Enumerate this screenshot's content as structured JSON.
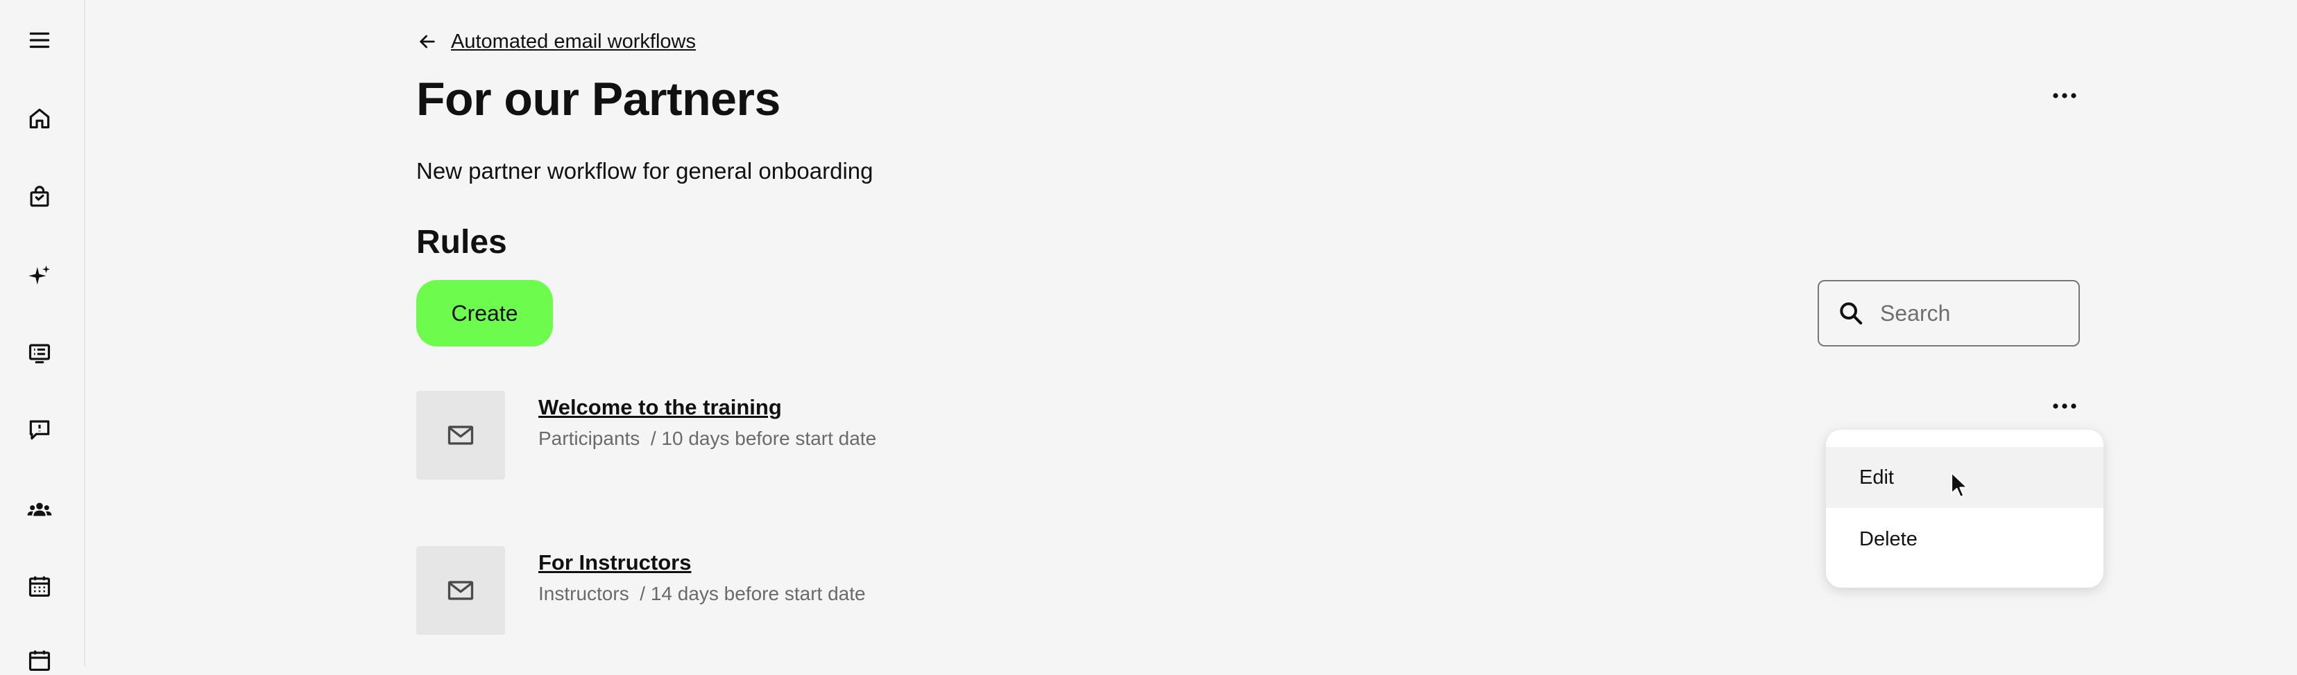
{
  "sidebar": {
    "items": [
      {
        "icon": "menu-icon"
      },
      {
        "icon": "home-icon"
      },
      {
        "icon": "shopping-bag-icon"
      },
      {
        "icon": "sparkles-icon"
      },
      {
        "icon": "list-screen-icon"
      },
      {
        "icon": "feedback-icon"
      },
      {
        "icon": "users-icon"
      },
      {
        "icon": "calendar-icon"
      },
      {
        "icon": "calendar-icon"
      }
    ]
  },
  "breadcrumb": {
    "back_label": "Automated email workflows"
  },
  "page": {
    "title": "For our Partners",
    "description": "New partner workflow for general onboarding"
  },
  "rules": {
    "section_title": "Rules",
    "create_label": "Create",
    "search_placeholder": "Search",
    "items": [
      {
        "title": "Welcome to the training",
        "meta": "Participants  / 10 days before start date"
      },
      {
        "title": "For Instructors",
        "meta": "Instructors  / 14 days before start date"
      }
    ]
  },
  "menu": {
    "items": [
      {
        "label": "Edit",
        "hovered": true
      },
      {
        "label": "Delete",
        "hovered": false
      }
    ]
  },
  "colors": {
    "accent": "#6dfc4e",
    "background": "#f5f5f5",
    "thumb": "#e6e6e6"
  }
}
